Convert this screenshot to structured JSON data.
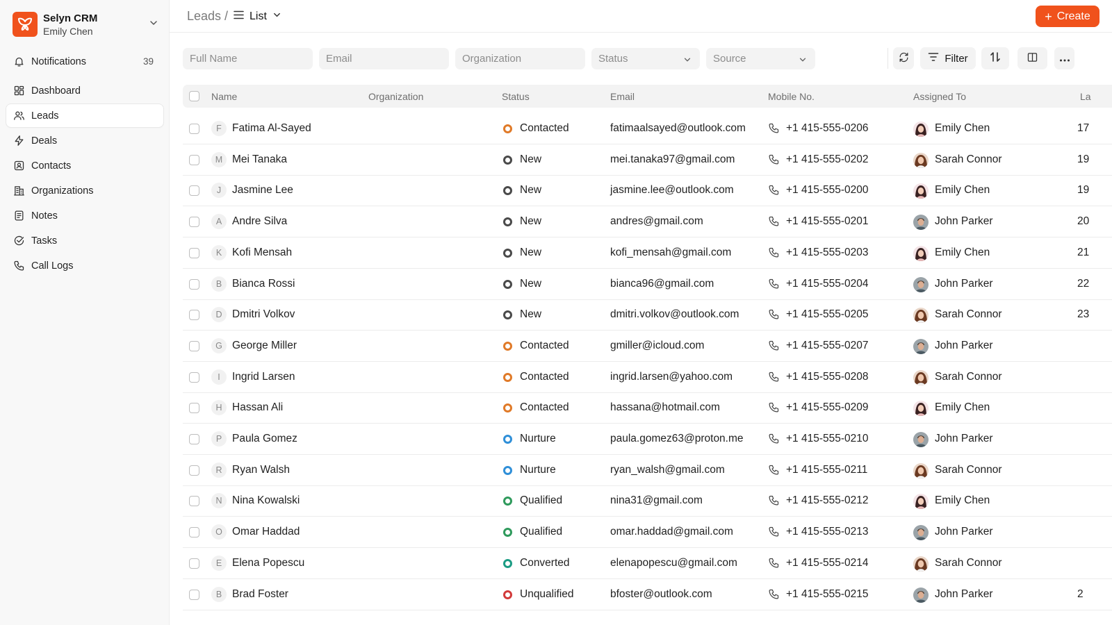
{
  "app": {
    "title": "Selyn CRM",
    "user": "Emily Chen",
    "brand_color": "#f0521c"
  },
  "sidebar": {
    "items": [
      {
        "label": "Notifications",
        "icon": "bell-icon",
        "count": "39"
      },
      {
        "label": "Dashboard",
        "icon": "dashboard-icon"
      },
      {
        "label": "Leads",
        "icon": "users-icon",
        "active": true
      },
      {
        "label": "Deals",
        "icon": "lightning-icon"
      },
      {
        "label": "Contacts",
        "icon": "contact-card-icon"
      },
      {
        "label": "Organizations",
        "icon": "building-icon"
      },
      {
        "label": "Notes",
        "icon": "note-icon"
      },
      {
        "label": "Tasks",
        "icon": "check-circle-icon"
      },
      {
        "label": "Call Logs",
        "icon": "phone-icon"
      }
    ]
  },
  "header": {
    "breadcrumb_root": "Leads /",
    "view_label": "List",
    "create_label": "Create"
  },
  "filters": {
    "full_name_placeholder": "Full Name",
    "email_placeholder": "Email",
    "organization_placeholder": "Organization",
    "status_placeholder": "Status",
    "source_placeholder": "Source",
    "filter_label": "Filter"
  },
  "table": {
    "columns": [
      "Name",
      "Organization",
      "Status",
      "Email",
      "Mobile No.",
      "Assigned To",
      "La"
    ],
    "status_colors": {
      "Contacted": "#e07a28",
      "New": "#4a4a4a",
      "Nurture": "#2f8fd8",
      "Qualified": "#2f9a5c",
      "Converted": "#1c9c84",
      "Unqualified": "#d23a3a"
    },
    "rows": [
      {
        "initial": "F",
        "name": "Fatima Al-Sayed",
        "status": "Contacted",
        "email": "fatimaalsayed@outlook.com",
        "phone": "+1 415-555-0206",
        "assigned": "Emily Chen",
        "extra": "17"
      },
      {
        "initial": "M",
        "name": "Mei Tanaka",
        "status": "New",
        "email": "mei.tanaka97@gmail.com",
        "phone": "+1 415-555-0202",
        "assigned": "Sarah Connor",
        "extra": "19"
      },
      {
        "initial": "J",
        "name": "Jasmine Lee",
        "status": "New",
        "email": "jasmine.lee@outlook.com",
        "phone": "+1 415-555-0200",
        "assigned": "Emily Chen",
        "extra": "19"
      },
      {
        "initial": "A",
        "name": "Andre Silva",
        "status": "New",
        "email": "andres@gmail.com",
        "phone": "+1 415-555-0201",
        "assigned": "John Parker",
        "extra": "20"
      },
      {
        "initial": "K",
        "name": "Kofi Mensah",
        "status": "New",
        "email": "kofi_mensah@gmail.com",
        "phone": "+1 415-555-0203",
        "assigned": "Emily Chen",
        "extra": "21"
      },
      {
        "initial": "B",
        "name": "Bianca Rossi",
        "status": "New",
        "email": "bianca96@gmail.com",
        "phone": "+1 415-555-0204",
        "assigned": "John Parker",
        "extra": "22"
      },
      {
        "initial": "D",
        "name": "Dmitri Volkov",
        "status": "New",
        "email": "dmitri.volkov@outlook.com",
        "phone": "+1 415-555-0205",
        "assigned": "Sarah Connor",
        "extra": "23"
      },
      {
        "initial": "G",
        "name": "George Miller",
        "status": "Contacted",
        "email": "gmiller@icloud.com",
        "phone": "+1 415-555-0207",
        "assigned": "John Parker",
        "extra": ""
      },
      {
        "initial": "I",
        "name": "Ingrid Larsen",
        "status": "Contacted",
        "email": "ingrid.larsen@yahoo.com",
        "phone": "+1 415-555-0208",
        "assigned": "Sarah Connor",
        "extra": ""
      },
      {
        "initial": "H",
        "name": "Hassan Ali",
        "status": "Contacted",
        "email": "hassana@hotmail.com",
        "phone": "+1 415-555-0209",
        "assigned": "Emily Chen",
        "extra": ""
      },
      {
        "initial": "P",
        "name": "Paula Gomez",
        "status": "Nurture",
        "email": "paula.gomez63@proton.me",
        "phone": "+1 415-555-0210",
        "assigned": "John Parker",
        "extra": ""
      },
      {
        "initial": "R",
        "name": "Ryan Walsh",
        "status": "Nurture",
        "email": "ryan_walsh@gmail.com",
        "phone": "+1 415-555-0211",
        "assigned": "Sarah Connor",
        "extra": ""
      },
      {
        "initial": "N",
        "name": "Nina Kowalski",
        "status": "Qualified",
        "email": "nina31@gmail.com",
        "phone": "+1 415-555-0212",
        "assigned": "Emily Chen",
        "extra": ""
      },
      {
        "initial": "O",
        "name": "Omar Haddad",
        "status": "Qualified",
        "email": "omar.haddad@gmail.com",
        "phone": "+1 415-555-0213",
        "assigned": "John Parker",
        "extra": ""
      },
      {
        "initial": "E",
        "name": "Elena Popescu",
        "status": "Converted",
        "email": "elenapopescu@gmail.com",
        "phone": "+1 415-555-0214",
        "assigned": "Sarah Connor",
        "extra": ""
      },
      {
        "initial": "B",
        "name": "Brad Foster",
        "status": "Unqualified",
        "email": "bfoster@outlook.com",
        "phone": "+1 415-555-0215",
        "assigned": "John Parker",
        "extra": "2"
      }
    ]
  }
}
